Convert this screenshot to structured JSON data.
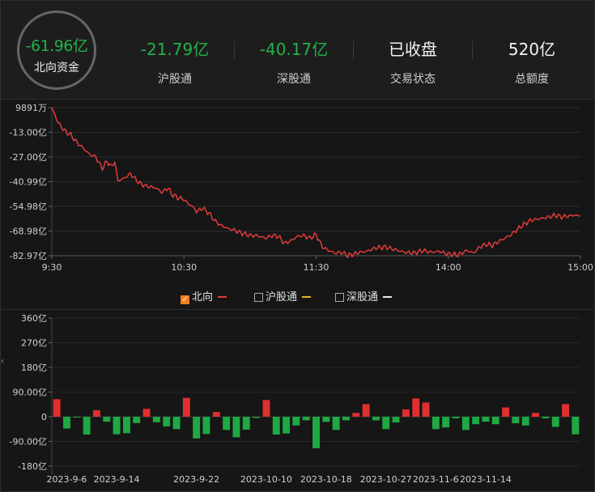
{
  "header": {
    "main": {
      "value": "-61.96亿",
      "label": "北向资金"
    },
    "stats": [
      {
        "value": "-21.79亿",
        "label": "沪股通",
        "color": "#25b04a"
      },
      {
        "value": "-40.17亿",
        "label": "深股通",
        "color": "#25b04a"
      },
      {
        "value": "已收盘",
        "label": "交易状态",
        "color": "#f2f2f2"
      },
      {
        "value": "520亿",
        "label": "总额度",
        "color": "#f2f2f2"
      }
    ]
  },
  "legend": [
    {
      "label": "北向",
      "checked": true,
      "color": "#e03b3b"
    },
    {
      "label": "沪股通",
      "checked": false,
      "color": "#e8b923"
    },
    {
      "label": "深股通",
      "checked": false,
      "color": "#e8e8e8"
    }
  ],
  "chart_data": [
    {
      "type": "line",
      "series": [
        {
          "name": "北向",
          "color": "#e03b3b"
        }
      ],
      "y_ticks": [
        "9891万",
        "-13.00亿",
        "-27.00亿",
        "-40.99亿",
        "-54.98亿",
        "-68.98亿",
        "-82.97亿"
      ],
      "y_tick_values": [
        0.99,
        -13.0,
        -27.0,
        -40.99,
        -54.98,
        -68.98,
        -82.97
      ],
      "x_ticks": [
        "9:30",
        "10:30",
        "11:30",
        "14:00",
        "15:00"
      ],
      "ylim": [
        -82.97,
        0.99
      ],
      "x_points": 241,
      "keypoints": [
        [
          0,
          0.99
        ],
        [
          4,
          -7.5
        ],
        [
          8,
          -12.0
        ],
        [
          12,
          -14.5
        ],
        [
          16,
          -18.8
        ],
        [
          20,
          -22.0
        ],
        [
          24,
          -25.5
        ],
        [
          28,
          -27.0
        ],
        [
          32,
          -33.5
        ],
        [
          35,
          -29.5
        ],
        [
          38,
          -32.5
        ],
        [
          40,
          -29.5
        ],
        [
          42,
          -40.5
        ],
        [
          46,
          -39.0
        ],
        [
          50,
          -36.5
        ],
        [
          52,
          -38.5
        ],
        [
          56,
          -42.0
        ],
        [
          60,
          -43.5
        ],
        [
          66,
          -44.5
        ],
        [
          70,
          -47.0
        ],
        [
          74,
          -44.5
        ],
        [
          76,
          -48.0
        ],
        [
          80,
          -50.0
        ],
        [
          84,
          -51.0
        ],
        [
          86,
          -53.0
        ],
        [
          90,
          -55.5
        ],
        [
          92,
          -58.0
        ],
        [
          96,
          -56.0
        ],
        [
          100,
          -59.0
        ],
        [
          104,
          -63.5
        ],
        [
          108,
          -66.0
        ],
        [
          112,
          -67.5
        ],
        [
          116,
          -68.5
        ],
        [
          120,
          -70.0
        ],
        [
          126,
          -71.5
        ],
        [
          130,
          -71.5
        ],
        [
          136,
          -73.0
        ],
        [
          140,
          -71.5
        ],
        [
          144,
          -72.0
        ],
        [
          148,
          -76.0
        ],
        [
          152,
          -74.5
        ],
        [
          156,
          -72.0
        ],
        [
          160,
          -71.5
        ],
        [
          164,
          -73.0
        ],
        [
          168,
          -71.0
        ],
        [
          172,
          -78.0
        ],
        [
          176,
          -80.0
        ],
        [
          180,
          -81.5
        ],
        [
          184,
          -81.0
        ],
        [
          188,
          -82.8
        ],
        [
          192,
          -82.0
        ],
        [
          196,
          -81.0
        ],
        [
          200,
          -80.5
        ],
        [
          206,
          -78.5
        ],
        [
          212,
          -78.0
        ],
        [
          218,
          -79.5
        ],
        [
          224,
          -81.0
        ],
        [
          230,
          -81.5
        ],
        [
          236,
          -80.0
        ],
        [
          241,
          -81.0
        ],
        [
          246,
          -80.5
        ],
        [
          252,
          -82.0
        ],
        [
          258,
          -82.5
        ],
        [
          264,
          -80.0
        ],
        [
          268,
          -81.5
        ],
        [
          272,
          -78.0
        ],
        [
          276,
          -76.5
        ],
        [
          280,
          -77.0
        ],
        [
          286,
          -74.0
        ],
        [
          292,
          -71.0
        ],
        [
          298,
          -66.5
        ],
        [
          304,
          -63.0
        ],
        [
          310,
          -62.0
        ],
        [
          316,
          -61.0
        ],
        [
          320,
          -60.0
        ],
        [
          324,
          -61.0
        ],
        [
          328,
          -60.5
        ],
        [
          332,
          -60.0
        ],
        [
          336,
          -60.5
        ]
      ]
    },
    {
      "type": "bar",
      "y_ticks": [
        "360亿",
        "270亿",
        "180亿",
        "90.00亿",
        "0",
        "-90.00亿",
        "-180亿"
      ],
      "y_tick_values": [
        360,
        270,
        180,
        90,
        0,
        -90,
        -180
      ],
      "ylim": [
        -180,
        360
      ],
      "x_tick_labels": [
        "2023-9-6",
        "2023-9-14",
        "2023-9-22",
        "2023-10-10",
        "2023-10-18",
        "2023-10-27",
        "2023-11-6",
        "2023-11-14"
      ],
      "x_tick_index": [
        1,
        6,
        14,
        21,
        27,
        33,
        38,
        43
      ],
      "colors": {
        "positive": "#e02f2f",
        "negative": "#1fa843"
      },
      "values": [
        64,
        -43,
        -3,
        -65,
        24,
        -18,
        -64,
        -60,
        -23,
        29,
        -20,
        -35,
        -45,
        69,
        -79,
        -63,
        17,
        -48,
        -75,
        -47,
        -4,
        61,
        -65,
        -61,
        -32,
        -13,
        -115,
        -19,
        -48,
        -13,
        14,
        46,
        -13,
        -45,
        -21,
        27,
        67,
        52,
        -45,
        -39,
        -6,
        -48,
        -27,
        -18,
        -27,
        34,
        -24,
        -32,
        14,
        -6,
        -37,
        46,
        -64
      ]
    }
  ]
}
